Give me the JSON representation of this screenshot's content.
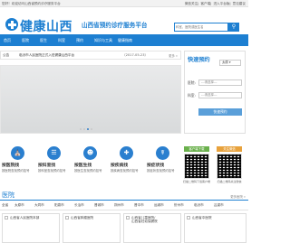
{
  "topbar": {
    "left_text": "您好！欢迎访问山西省预约诊疗服务平台",
    "links": [
      "微信关注",
      "客户端",
      "进入平台版",
      "意见建议"
    ]
  },
  "header": {
    "logo_text": "健康山西",
    "slogan": "山西省预约诊疗服务平台",
    "search_placeholder": "科室、医院或医生名",
    "search_icon": "search-icon"
  },
  "nav": {
    "items": [
      "首页",
      "医院",
      "医生",
      "科室",
      "预约",
      "知识与工具",
      "健康指南"
    ]
  },
  "notice": {
    "label": "公告",
    "text": "临汾市人民医院正式入驻健康山西平台",
    "date": "（2017-05-23）",
    "more": "更多 »"
  },
  "banner": {
    "dots": 4,
    "active_index": 2
  },
  "booking": {
    "title": "快速预约",
    "city": "太原",
    "hospital_label": "医院:",
    "hospital_value": "---请选择---",
    "dept_label": "科室:",
    "dept_value": "---请选择---",
    "button_label": "快速预约"
  },
  "features": [
    {
      "title": "按医院找",
      "desc": "按医院查找预约挂号",
      "icon": "hospital-icon"
    },
    {
      "title": "按科室找",
      "desc": "按科室查找预约挂号",
      "icon": "department-icon"
    },
    {
      "title": "按医生找",
      "desc": "按医生查找预约挂号",
      "icon": "doctor-icon"
    },
    {
      "title": "按疾病找",
      "desc": "按疾病查找预约挂号",
      "icon": "disease-icon"
    },
    {
      "title": "按症状找",
      "desc": "按症状查找预约挂号",
      "icon": "symptom-icon"
    }
  ],
  "qr": [
    {
      "label": "客户端下载",
      "caption": "扫描二维码下载客户端",
      "color": "#6ab04c"
    },
    {
      "label": "关注微信",
      "caption": "扫描二维码关注微信",
      "color": "#e8a23c"
    }
  ],
  "hospital_section": {
    "title": "医院",
    "more": "更多医院 »",
    "cities": [
      "全省",
      "太原市",
      "大同市",
      "阳泉市",
      "长治市",
      "晋城市",
      "朔州市",
      "晋中市",
      "运城市",
      "忻州市",
      "临汾市",
      "吕梁市"
    ],
    "cards": [
      {
        "line1": "山西省人民医院本部"
      },
      {
        "line1": "山西省肿瘤医院"
      },
      {
        "line1": "山西省儿童医院/",
        "line2": "山西省妇幼保健院"
      },
      {
        "line1": "山西省中医院"
      }
    ]
  }
}
